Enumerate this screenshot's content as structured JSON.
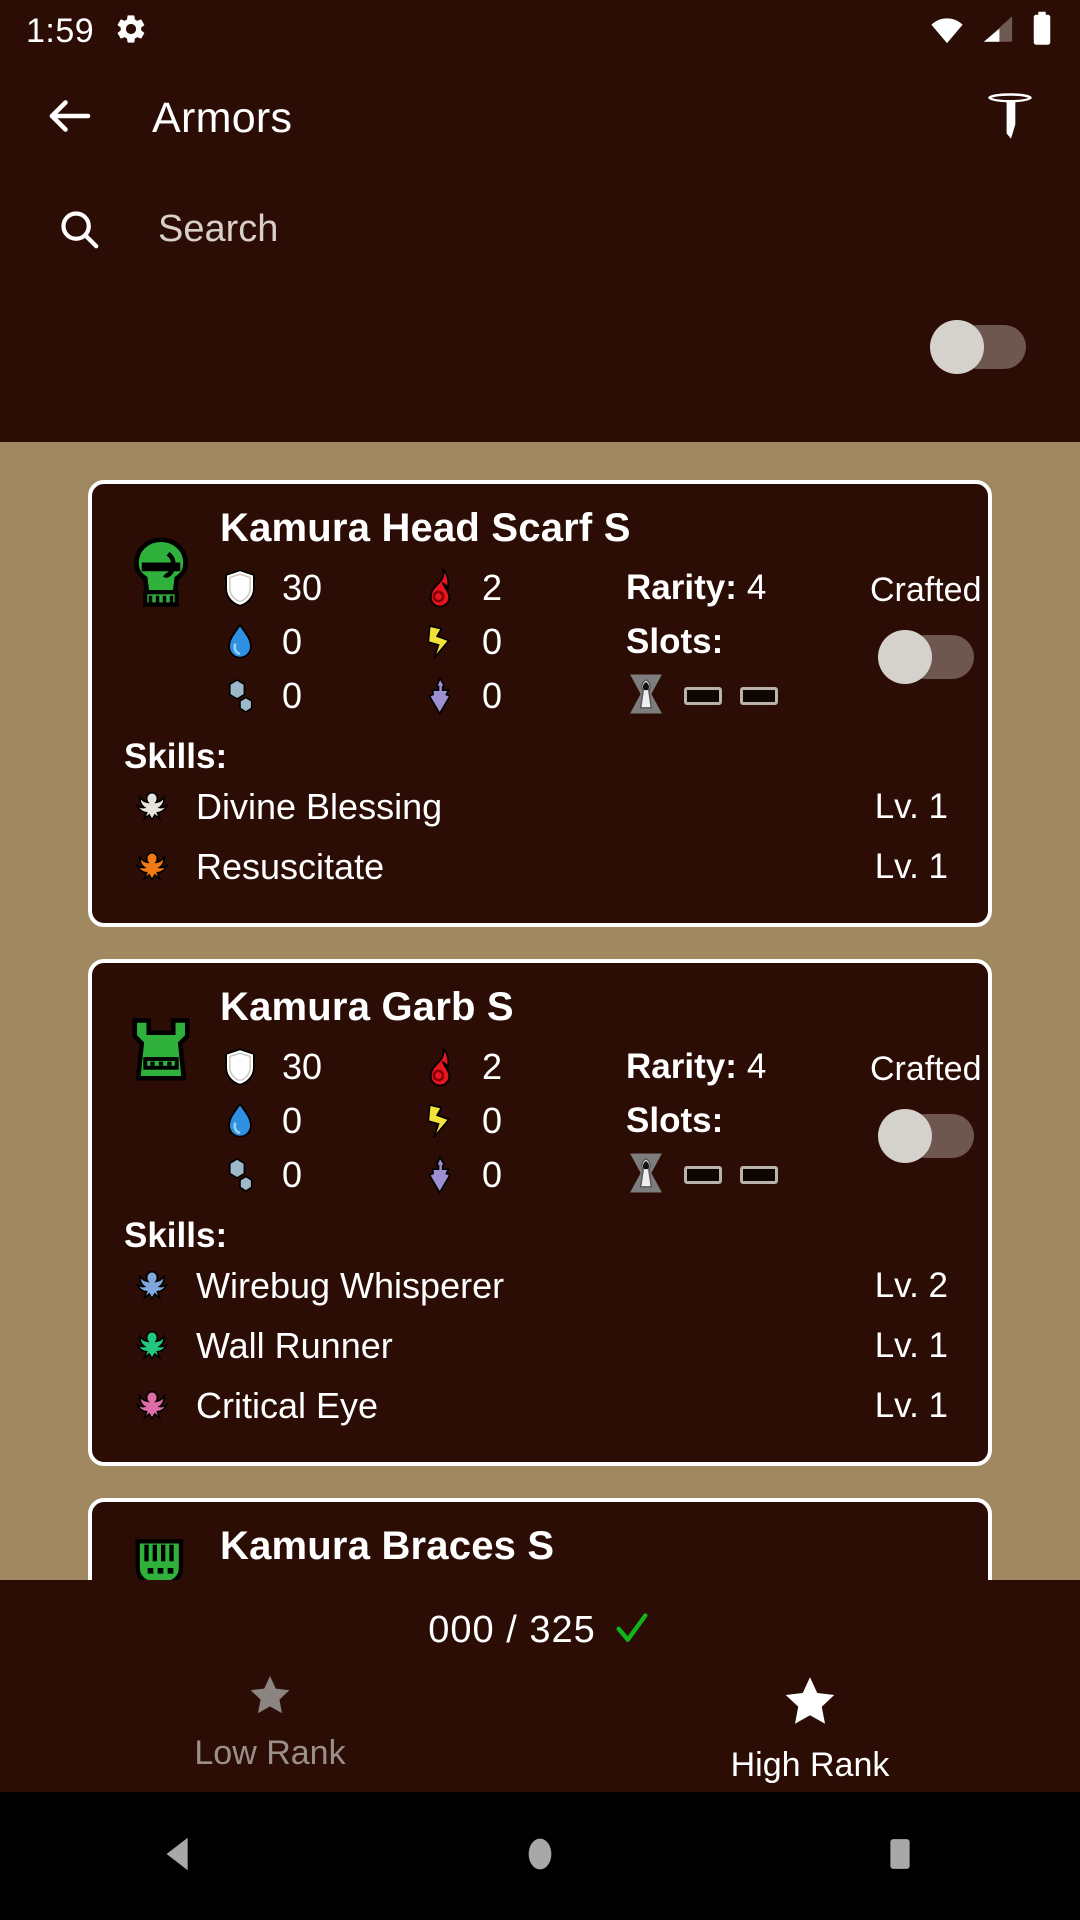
{
  "status_bar": {
    "clock": "1:59",
    "icons": [
      "gear-icon",
      "wifi-icon",
      "cell-signal-icon",
      "battery-icon"
    ]
  },
  "app_bar": {
    "back_icon": "arrow-back-icon",
    "title": "Armors",
    "filter_icon": "filter-funnel-icon"
  },
  "search": {
    "icon": "search-icon",
    "value": "",
    "placeholder": "Search"
  },
  "top_toggle": {
    "state": "off"
  },
  "colors": {
    "app_background": "#2b0d06",
    "list_background": "#a08860",
    "card_background": "#2b0d06",
    "card_border": "#ffffff",
    "text_primary": "#ffffff",
    "text_muted": "#9b8f8b",
    "check_green": "#12b41b",
    "armor_icon_green": "#2fb13b",
    "fire_red": "#e8141e",
    "water_blue": "#2f8fe0",
    "thunder_yellow": "#f2e23a",
    "ice_lightblue": "#9db8c9",
    "dragon_purple": "#9b8fd1",
    "switch_thumb": "#d5d2ce",
    "switch_track": "#6d574f"
  },
  "stat_labels": {
    "defense": "defense",
    "fire": "fire",
    "water": "water",
    "thunder": "thunder",
    "ice": "ice",
    "dragon": "dragon"
  },
  "card_labels": {
    "rarity": "Rarity:",
    "slots": "Slots:",
    "skills": "Skills:",
    "crafted": "Crafted"
  },
  "armors": [
    {
      "name": "Kamura Head Scarf S",
      "icon": "helmet-icon",
      "defense": "30",
      "fire": "2",
      "water": "0",
      "thunder": "0",
      "ice": "0",
      "dragon": "0",
      "rarity": "4",
      "slots": [
        "filled",
        "empty",
        "empty"
      ],
      "crafted_label": "Crafted",
      "crafted_state": "off",
      "skills": [
        {
          "name": "Divine Blessing",
          "level": "Lv. 1",
          "icon_color": "#e8e3dd"
        },
        {
          "name": "Resuscitate",
          "level": "Lv. 1",
          "icon_color": "#f07a16"
        }
      ]
    },
    {
      "name": "Kamura Garb S",
      "icon": "chest-icon",
      "defense": "30",
      "fire": "2",
      "water": "0",
      "thunder": "0",
      "ice": "0",
      "dragon": "0",
      "rarity": "4",
      "slots": [
        "filled",
        "empty",
        "empty"
      ],
      "crafted_label": "Crafted",
      "crafted_state": "off",
      "skills": [
        {
          "name": "Wirebug Whisperer",
          "level": "Lv. 2",
          "icon_color": "#7fa8dd"
        },
        {
          "name": "Wall Runner",
          "level": "Lv. 1",
          "icon_color": "#24c77e"
        },
        {
          "name": "Critical Eye",
          "level": "Lv. 1",
          "icon_color": "#e06ba6"
        }
      ]
    },
    {
      "name": "Kamura Braces S",
      "icon": "arms-icon",
      "partial": true
    }
  ],
  "bottom_bar": {
    "counter": "000 / 325",
    "check_icon": "check-icon",
    "tabs": [
      {
        "label": "Low Rank",
        "icon": "star-icon",
        "active": false
      },
      {
        "label": "High Rank",
        "icon": "star-icon",
        "active": true
      }
    ]
  },
  "nav_bar": {
    "back": "nav-back-icon",
    "home": "nav-home-icon",
    "recents": "nav-recents-icon"
  }
}
